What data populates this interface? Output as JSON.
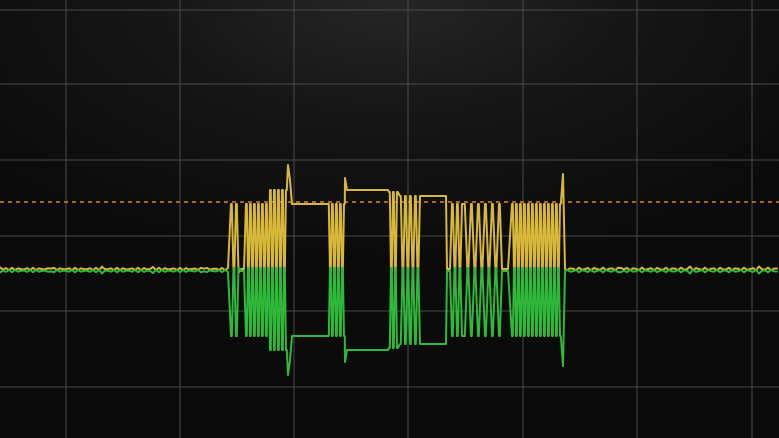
{
  "screen": {
    "background_color": "#0b0b0b",
    "grid_color": "#4a4a4a",
    "grid": {
      "columns": 7,
      "rows": 6
    }
  },
  "trigger": {
    "color": "#d9822b",
    "style": "dashed",
    "level_fraction_from_top": 0.462
  },
  "channels": [
    {
      "id": "yellow",
      "color": "#d8b83a"
    },
    {
      "id": "green",
      "color": "#2fb83a"
    }
  ]
}
